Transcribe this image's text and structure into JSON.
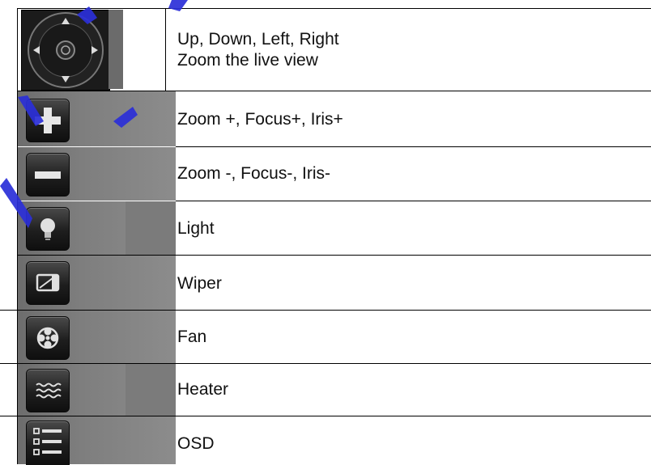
{
  "rows": [
    {
      "icon": "ptz-direction-pad-icon",
      "line1": "Up, Down, Left, Right",
      "line2": "Zoom the live view"
    },
    {
      "icon": "plus-icon",
      "text": "Zoom +, Focus+, Iris+"
    },
    {
      "icon": "minus-icon",
      "text": "Zoom -, Focus-, Iris-"
    },
    {
      "icon": "light-bulb-icon",
      "text": "Light"
    },
    {
      "icon": "wiper-icon",
      "text": "Wiper"
    },
    {
      "icon": "fan-icon",
      "text": "Fan"
    },
    {
      "icon": "heater-icon",
      "text": "Heater"
    },
    {
      "icon": "osd-menu-icon",
      "text": "OSD"
    }
  ],
  "colors": {
    "watermark": "#2b2fd8",
    "icon_cell_bg": "#8a8a8a",
    "button_bg": "#1e1e1e"
  }
}
